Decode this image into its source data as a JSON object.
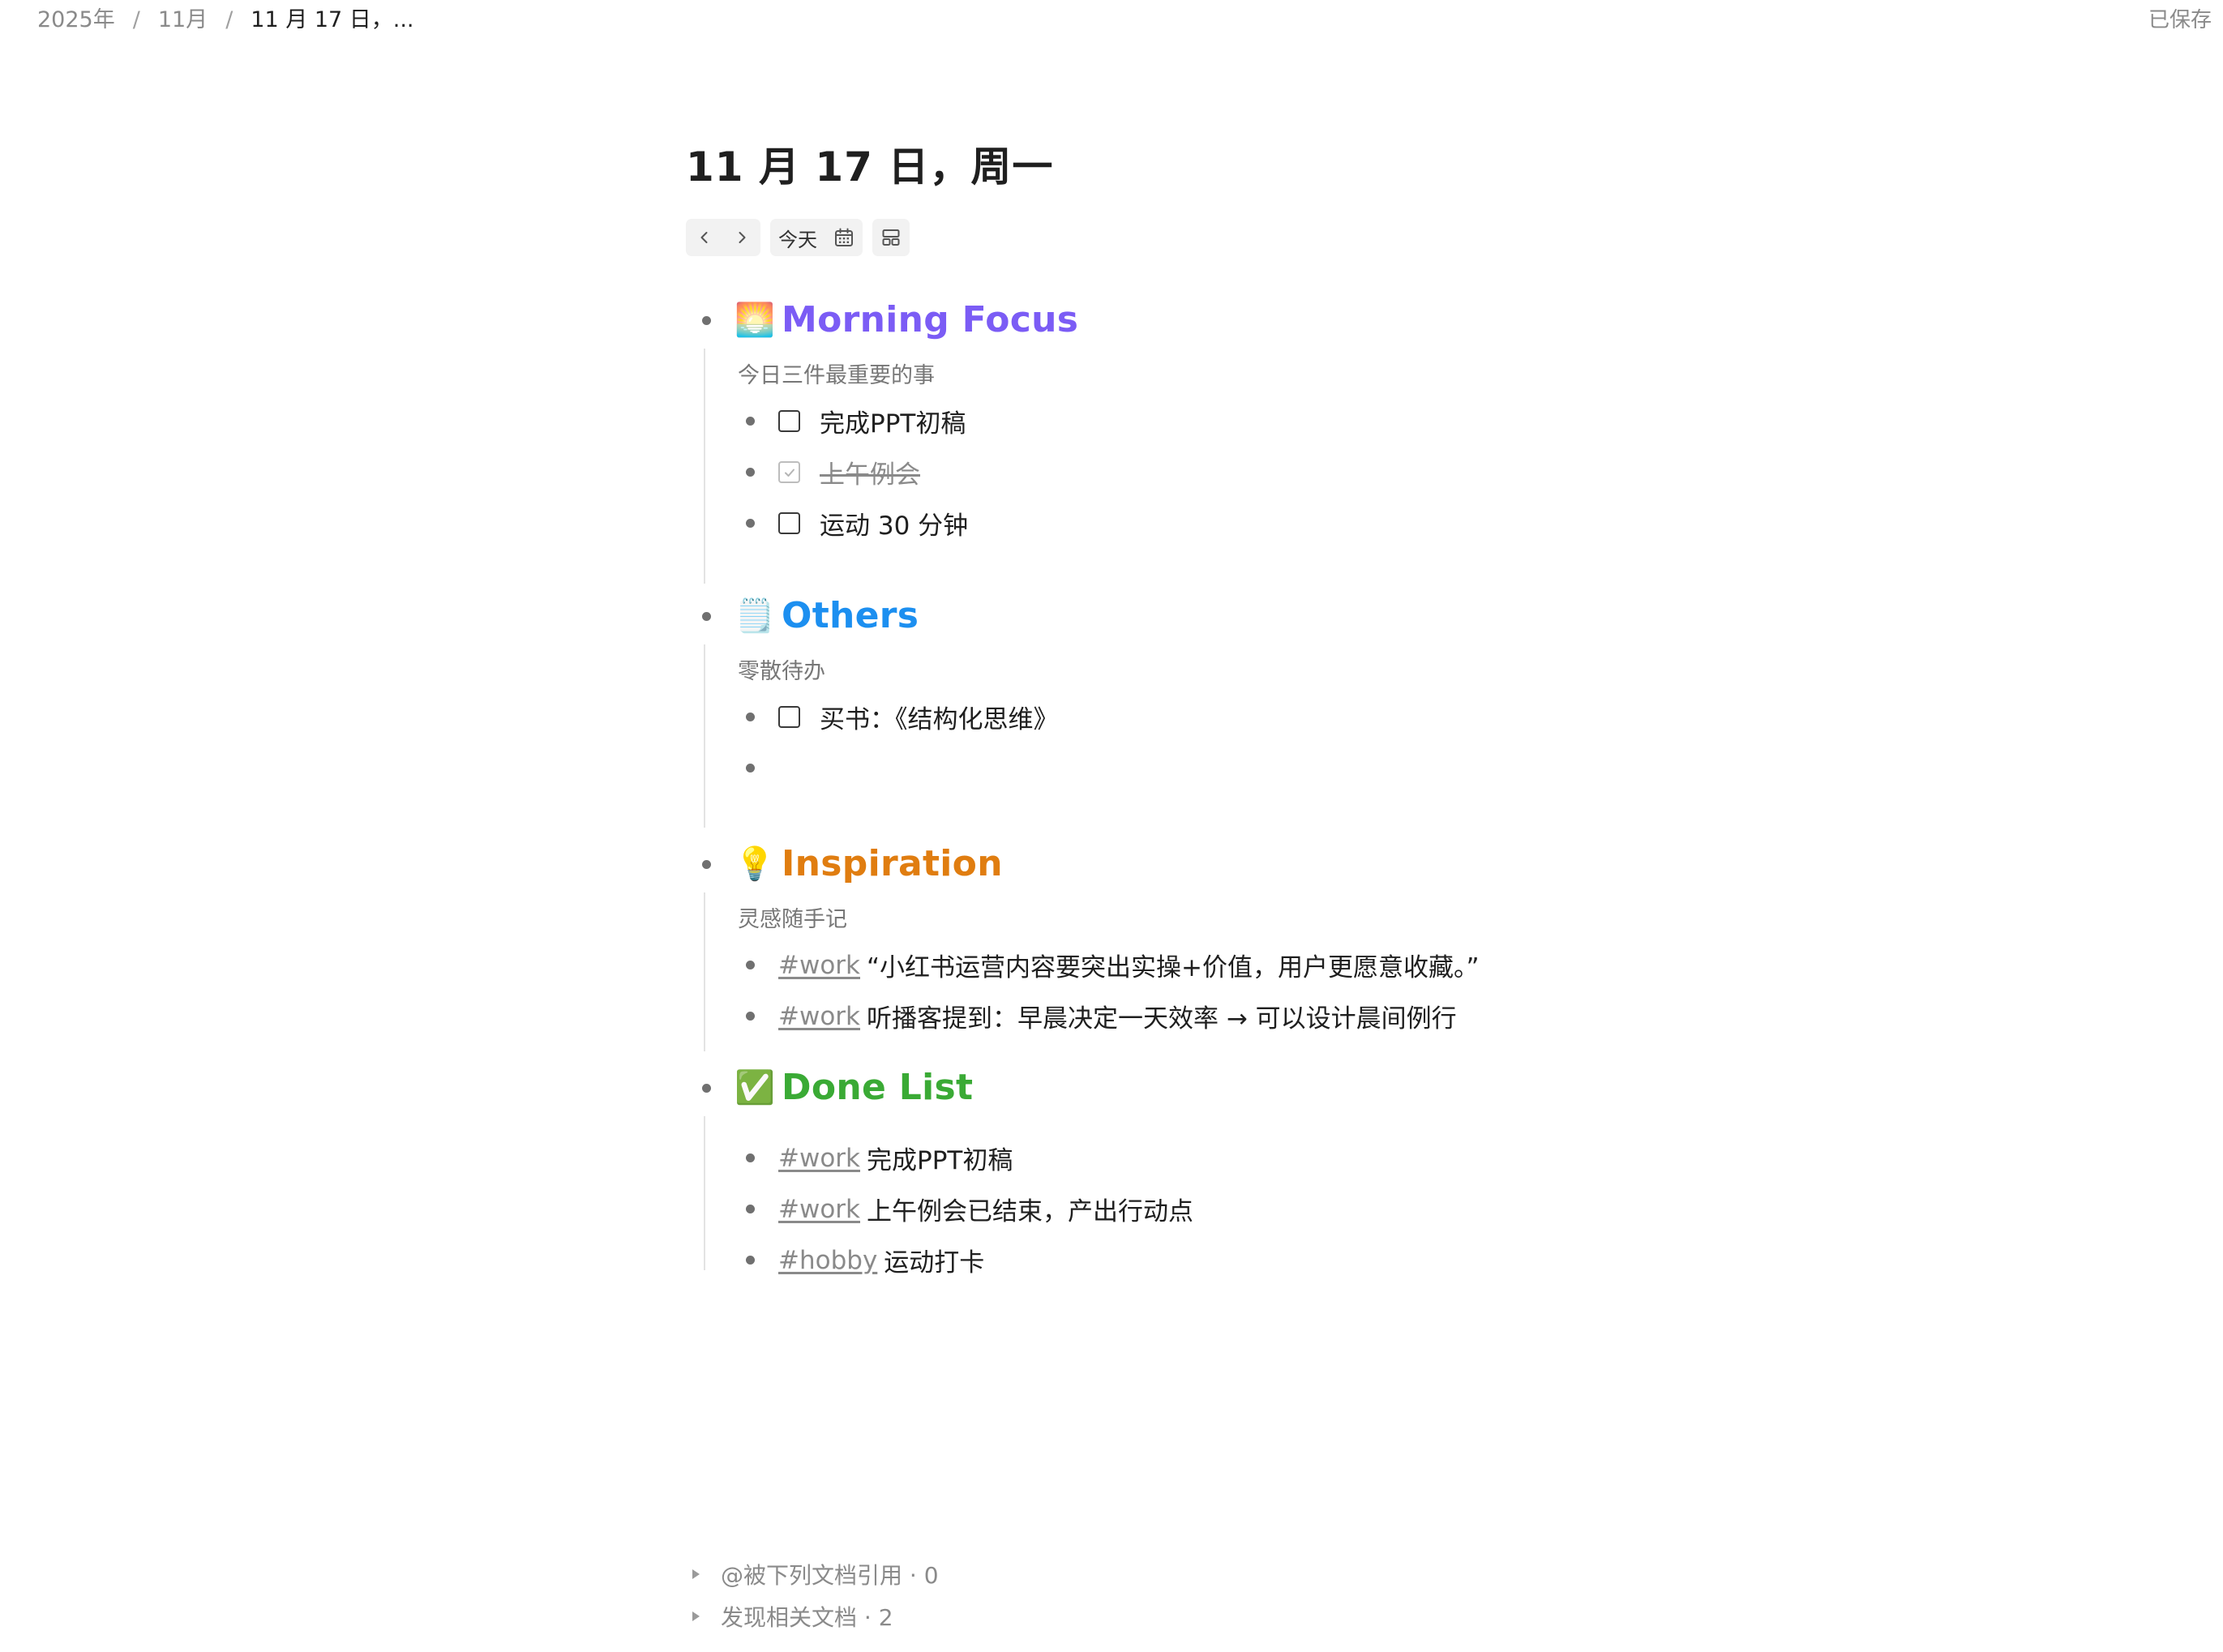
{
  "breadcrumb": {
    "year": "2025年",
    "month": "11月",
    "current": "11 月 17 日，...",
    "separator": "/"
  },
  "status": {
    "saved": "已保存"
  },
  "page": {
    "title": "11 月 17 日，周一"
  },
  "toolbar": {
    "prev_icon": "chevron-left-icon",
    "next_icon": "chevron-right-icon",
    "today_label": "今天",
    "calendar_icon": "calendar-icon",
    "layout_icon": "layout-icon"
  },
  "sections": {
    "morning": {
      "emoji": "🌅",
      "title": "Morning Focus",
      "color": "#7b5cf5",
      "desc": "今日三件最重要的事",
      "items": [
        {
          "text": "完成PPT初稿",
          "checked": false
        },
        {
          "text": "上午例会",
          "checked": true
        },
        {
          "text": "运动 30 分钟",
          "checked": false
        }
      ]
    },
    "others": {
      "emoji": "🗒️",
      "title": "Others",
      "color": "#1c8ff0",
      "desc": "零散待办",
      "items": [
        {
          "text": "买书：《结构化思维》",
          "checked": false
        }
      ]
    },
    "inspiration": {
      "emoji": "💡",
      "title": "Inspiration",
      "color": "#e07d10",
      "desc": "灵感随手记",
      "items": [
        {
          "tag": "#work",
          "text": "“小红书运营内容要突出实操+价值，用户更愿意收藏。”"
        },
        {
          "tag": "#work",
          "text": "听播客提到：早晨决定一天效率 → 可以设计晨间例行"
        }
      ]
    },
    "done": {
      "emoji": "✅",
      "title": "Done List",
      "color": "#3aaa35",
      "items": [
        {
          "tag": "#work",
          "text": "完成PPT初稿"
        },
        {
          "tag": "#work",
          "text": "上午例会已结束，产出行动点"
        },
        {
          "tag": "#hobby",
          "text": "运动打卡"
        }
      ]
    }
  },
  "footer": {
    "backlinks": "@被下列文档引用 · 0",
    "related": "发现相关文档 · 2"
  }
}
